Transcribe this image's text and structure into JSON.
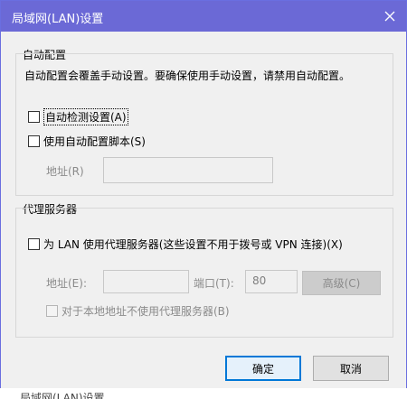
{
  "window": {
    "title": "局域网(LAN)设置"
  },
  "auto_config": {
    "heading": "自动配置",
    "description": "自动配置会覆盖手动设置。要确保使用手动设置，请禁用自动配置。",
    "auto_detect": {
      "label": "自动检测设置(A)",
      "checked": false
    },
    "auto_script": {
      "label": "使用自动配置脚本(S)",
      "checked": false
    },
    "address_label": "地址(R)",
    "address_value": ""
  },
  "proxy": {
    "heading": "代理服务器",
    "use_proxy": {
      "label": "为 LAN 使用代理服务器(这些设置不用于拨号或 VPN 连接)(X)",
      "checked": false
    },
    "address_label": "地址(E):",
    "address_value": "",
    "port_label": "端口(T):",
    "port_value": "80",
    "advanced_label": "高级(C)",
    "bypass_local": {
      "label": "对于本地地址不使用代理服务器(B)",
      "checked": false
    }
  },
  "buttons": {
    "ok": "确定",
    "cancel": "取消"
  },
  "behind_window": {
    "title": "局域网(LAN)设置"
  },
  "colors": {
    "titlebar": "#6b69d6",
    "ok_border": "#0078d7"
  }
}
